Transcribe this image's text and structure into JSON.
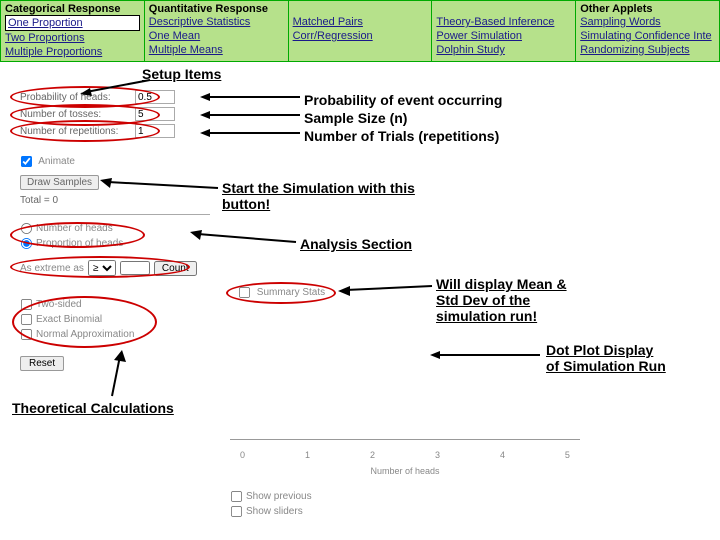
{
  "nav": {
    "col1": {
      "title": "Categorical Response",
      "links": [
        "One Proportion",
        "Two Proportions",
        "Multiple Proportions"
      ],
      "selected": 0
    },
    "col2": {
      "title": "Quantitative Response",
      "links": [
        "Descriptive Statistics",
        "One Mean",
        "Multiple Means"
      ]
    },
    "col3": {
      "title": "",
      "links": [
        "Matched Pairs",
        "Corr/Regression"
      ]
    },
    "col4": {
      "title": "",
      "links": [
        "Theory-Based Inference",
        "Power Simulation",
        "Dolphin Study"
      ]
    },
    "col5": {
      "title": "Other Applets",
      "links": [
        "Sampling Words",
        "Simulating Confidence Inte",
        "Randomizing Subjects"
      ]
    }
  },
  "setup": {
    "prob_label": "Probability of heads:",
    "prob_value": "0.5",
    "tosses_label": "Number of tosses:",
    "tosses_value": "5",
    "reps_label": "Number of repetitions:",
    "reps_value": "1",
    "animate_label": "Animate",
    "draw_label": "Draw Samples",
    "total_label": "Total = 0"
  },
  "analysis": {
    "num_heads": "Number of heads",
    "prop_heads": "Proportion of heads",
    "extreme_label": "As extreme as",
    "extreme_op": "≥",
    "count_label": "Count",
    "two_sided": "Two-sided",
    "exact_binom": "Exact Binomial",
    "normal_approx": "Normal Approximation",
    "reset_label": "Reset",
    "summary_label": "Summary Stats"
  },
  "chart": {
    "ticks": [
      "0",
      "1",
      "2",
      "3",
      "4",
      "5"
    ],
    "xlabel": "Number of heads"
  },
  "show": {
    "previous": "Show previous",
    "sliders": "Show sliders"
  },
  "ann": {
    "setup": "Setup Items",
    "prob": "Probability of event occurring",
    "size": "Sample Size (n)",
    "trials": "Number of Trials (repetitions)",
    "start": "Start the Simulation with this button!",
    "analysis": "Analysis Section",
    "summary": "Will display Mean & Std Dev of the simulation run!",
    "dotplot": "Dot Plot Display of Simulation Run",
    "theoretical": "Theoretical Calculations"
  }
}
